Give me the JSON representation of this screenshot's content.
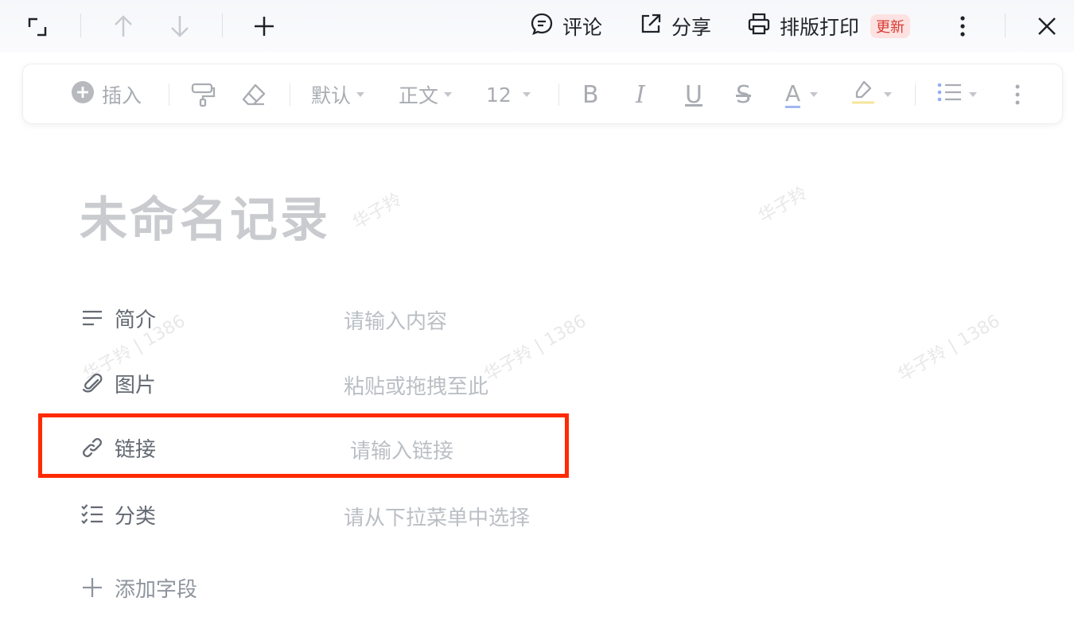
{
  "topbar": {
    "comment_label": "评论",
    "share_label": "分享",
    "print_label": "排版打印",
    "update_badge": "更新"
  },
  "toolbar": {
    "insert_label": "插入",
    "font_family": "默认",
    "paragraph_style": "正文",
    "font_size": "12",
    "bold_glyph": "B",
    "italic_glyph": "I",
    "underline_glyph": "U",
    "strike_glyph": "S",
    "font_color_glyph": "A"
  },
  "document": {
    "title": "未命名记录"
  },
  "fields": [
    {
      "label": "简介",
      "value": "请输入内容",
      "icon": "text-lines-icon"
    },
    {
      "label": "图片",
      "value": "粘贴或拖拽至此",
      "icon": "paperclip-icon"
    },
    {
      "label": "链接",
      "value": "请输入链接",
      "icon": "link-icon"
    },
    {
      "label": "分类",
      "value": "请从下拉菜单中选择",
      "icon": "checklist-icon"
    }
  ],
  "add_field_label": "添加字段",
  "watermark": {
    "name": "华子羚",
    "name_id": "华子羚 | 1386"
  },
  "colors": {
    "highlight_border": "#ff2a00",
    "badge_text": "#d83931",
    "badge_bg": "#fde2e1"
  }
}
